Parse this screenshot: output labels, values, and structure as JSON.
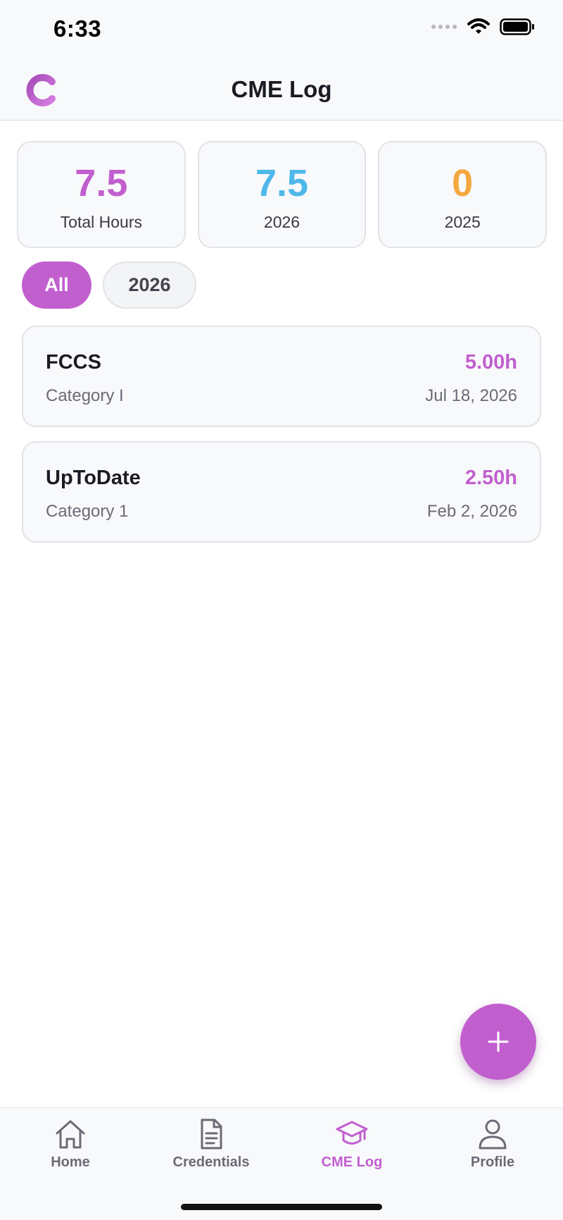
{
  "status_bar": {
    "time": "6:33",
    "icons": [
      "signal-icon",
      "wifi-icon",
      "battery-icon"
    ]
  },
  "header": {
    "logo_icon": "app-logo-icon",
    "title": "CME Log"
  },
  "stats": [
    {
      "value": "7.5",
      "label": "Total Hours",
      "color": "#c15fcf"
    },
    {
      "value": "7.5",
      "label": "2026",
      "color": "#4fb8ea"
    },
    {
      "value": "0",
      "label": "2025",
      "color": "#f5a83f"
    }
  ],
  "filters": [
    {
      "label": "All",
      "active": true
    },
    {
      "label": "2026",
      "active": false
    }
  ],
  "entries": [
    {
      "name": "FCCS",
      "category": "Category I",
      "hours": "5.00h",
      "date": "Jul 18, 2026"
    },
    {
      "name": "UpToDate",
      "category": "Category 1",
      "hours": "2.50h",
      "date": "Feb 2, 2026"
    }
  ],
  "fab": {
    "icon": "plus-icon"
  },
  "tabs": [
    {
      "label": "Home",
      "icon": "home-icon",
      "active": false
    },
    {
      "label": "Credentials",
      "icon": "document-icon",
      "active": false
    },
    {
      "label": "CME Log",
      "icon": "graduation-cap-icon",
      "active": true
    },
    {
      "label": "Profile",
      "icon": "user-icon",
      "active": false
    }
  ],
  "colors": {
    "accent": "#c15fcf",
    "blue": "#4fb8ea",
    "orange": "#f5a83f",
    "inactive": "#6b6b76"
  }
}
